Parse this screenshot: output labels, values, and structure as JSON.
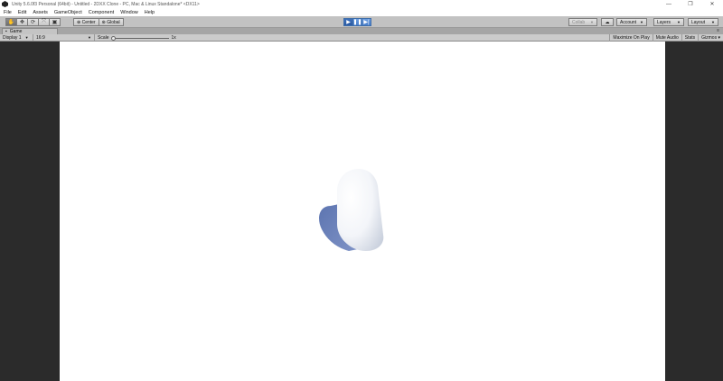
{
  "window": {
    "title": "Unity 5.6.0f3 Personal (64bit) - Untitled - 2DXX Clone - PC, Mac & Linux Standalone* <DX11>",
    "controls": {
      "minimize": "—",
      "maximize": "❐",
      "close": "✕"
    }
  },
  "menu": [
    "File",
    "Edit",
    "Assets",
    "GameObject",
    "Component",
    "Window",
    "Help"
  ],
  "toolbar": {
    "tools": [
      {
        "name": "hand",
        "glyph": "✋",
        "active": true
      },
      {
        "name": "move",
        "glyph": "✥",
        "active": false
      },
      {
        "name": "rotate",
        "glyph": "⟳",
        "active": false
      },
      {
        "name": "scale",
        "glyph": "⤧",
        "active": false
      },
      {
        "name": "rect",
        "glyph": "▣",
        "active": false
      }
    ],
    "pivot": {
      "center_glyph": "⊕",
      "center_label": "Center",
      "global_glyph": "⊛",
      "global_label": "Global"
    },
    "playback": {
      "play": "▶",
      "pause": "❚❚",
      "step": "▶|"
    },
    "collab_label": "Collab",
    "cloud_glyph": "☁",
    "account_label": "Account",
    "layers_label": "Layers",
    "layout_label": "Layout"
  },
  "game_view": {
    "tab_glyph": "▪",
    "tab_label": "Game",
    "tab_menu": "≡",
    "display_label": "Display 1",
    "aspect_label": "16:9",
    "scale_label": "Scale",
    "scale_value": "1x",
    "toggles": [
      "Maximize On Play",
      "Mute Audio",
      "Stats",
      "Gizmos ▾"
    ]
  },
  "colors": {
    "play_blue": "#4a7fcc",
    "viewport_background": "#ffffff",
    "letterbox": "#2b2b2b",
    "shadow": "#5c74b0"
  }
}
